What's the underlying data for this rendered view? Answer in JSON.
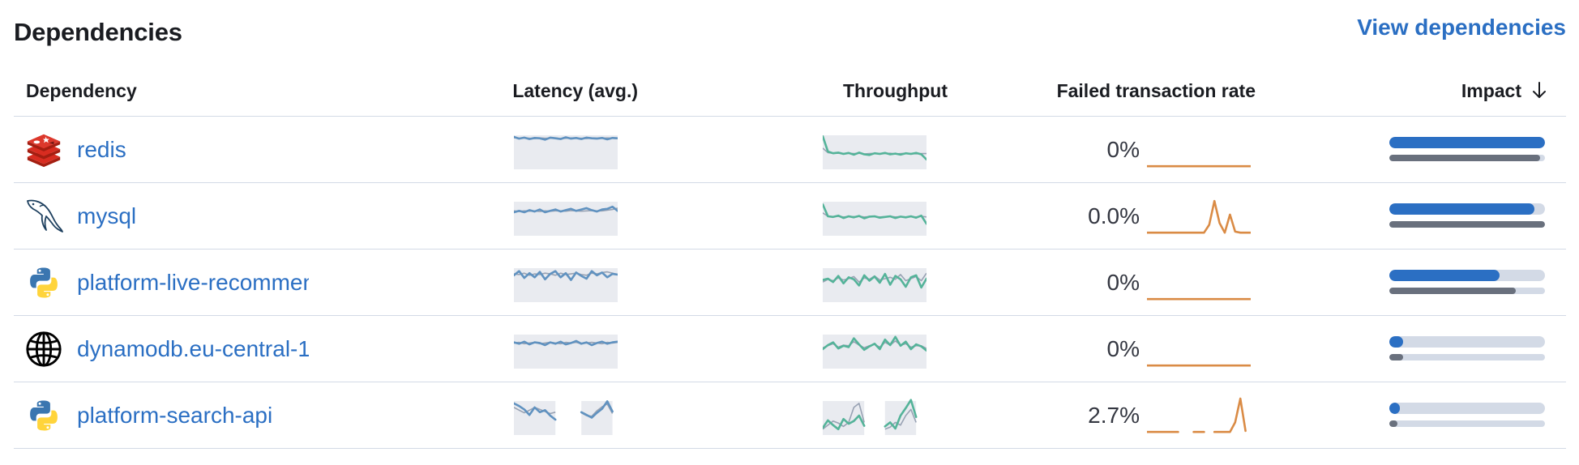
{
  "panel": {
    "title": "Dependencies",
    "view_link": "View dependencies"
  },
  "table": {
    "columns": {
      "dependency": "Dependency",
      "latency": "Latency (avg.)",
      "throughput": "Throughput",
      "failed": "Failed transaction rate",
      "impact": "Impact"
    },
    "sort_icon": "arrow-down-icon",
    "rows": [
      {
        "name": "redis",
        "icon": "redis-icon",
        "failed_rate": "0%",
        "impact": 1.0,
        "impact_previous": 0.97,
        "latency_series": [
          0.88,
          0.83,
          0.86,
          0.82,
          0.85,
          0.84,
          0.8,
          0.86,
          0.84,
          0.82,
          0.87,
          0.83,
          0.85,
          0.82,
          0.86,
          0.84,
          0.83,
          0.85,
          0.81,
          0.85,
          0.84
        ],
        "latency_previous": [
          0.86,
          0.84,
          0.85,
          0.84,
          0.83,
          0.85,
          0.84,
          0.84,
          0.85,
          0.83,
          0.84,
          0.85,
          0.84,
          0.84,
          0.83,
          0.85,
          0.84,
          0.84,
          0.85,
          0.84,
          0.83
        ],
        "throughput_series": [
          0.9,
          0.45,
          0.4,
          0.42,
          0.38,
          0.41,
          0.36,
          0.42,
          0.37,
          0.35,
          0.4,
          0.38,
          0.41,
          0.37,
          0.39,
          0.36,
          0.4,
          0.38,
          0.41,
          0.37,
          0.22
        ],
        "throughput_previous": [
          0.55,
          0.42,
          0.4,
          0.4,
          0.39,
          0.4,
          0.39,
          0.4,
          0.38,
          0.39,
          0.4,
          0.39,
          0.39,
          0.4,
          0.38,
          0.39,
          0.4,
          0.39,
          0.38,
          0.39,
          0.39
        ],
        "failed_series": [
          0.02,
          0.02,
          0.02,
          0.02,
          0.02,
          0.02,
          0.02,
          0.02,
          0.02,
          0.02,
          0.02,
          0.02,
          0.02,
          0.02,
          0.02,
          0.02,
          0.02,
          0.02,
          0.02,
          0.02,
          0.02
        ]
      },
      {
        "name": "mysql",
        "icon": "mysql-dolphin-icon",
        "failed_rate": "0.0%",
        "impact": 0.93,
        "impact_previous": 1.0,
        "latency_series": [
          0.62,
          0.66,
          0.62,
          0.68,
          0.64,
          0.7,
          0.62,
          0.66,
          0.7,
          0.64,
          0.68,
          0.72,
          0.66,
          0.7,
          0.74,
          0.68,
          0.64,
          0.7,
          0.72,
          0.78,
          0.66
        ],
        "latency_previous": [
          0.66,
          0.64,
          0.66,
          0.65,
          0.66,
          0.64,
          0.66,
          0.65,
          0.66,
          0.66,
          0.65,
          0.67,
          0.66,
          0.65,
          0.66,
          0.67,
          0.66,
          0.66,
          0.68,
          0.7,
          0.74
        ],
        "throughput_series": [
          0.85,
          0.5,
          0.48,
          0.52,
          0.45,
          0.5,
          0.47,
          0.51,
          0.44,
          0.49,
          0.5,
          0.46,
          0.48,
          0.5,
          0.45,
          0.49,
          0.47,
          0.5,
          0.46,
          0.52,
          0.28
        ],
        "throughput_previous": [
          0.6,
          0.5,
          0.49,
          0.5,
          0.48,
          0.49,
          0.49,
          0.5,
          0.48,
          0.49,
          0.49,
          0.48,
          0.49,
          0.5,
          0.48,
          0.49,
          0.48,
          0.49,
          0.48,
          0.5,
          0.48
        ],
        "failed_series": [
          0.02,
          0.02,
          0.02,
          0.02,
          0.02,
          0.02,
          0.02,
          0.02,
          0.02,
          0.02,
          0.02,
          0.02,
          0.25,
          0.95,
          0.3,
          0.02,
          0.55,
          0.05,
          0.02,
          0.02,
          0.02
        ]
      },
      {
        "name": "platform-live-recommendations",
        "icon": "python-icon",
        "failed_rate": "0%",
        "impact": 0.71,
        "impact_previous": 0.81,
        "latency_series": [
          0.72,
          0.84,
          0.64,
          0.78,
          0.66,
          0.82,
          0.6,
          0.76,
          0.84,
          0.66,
          0.78,
          0.58,
          0.8,
          0.7,
          0.62,
          0.84,
          0.72,
          0.8,
          0.66,
          0.76,
          0.74
        ],
        "latency_previous": [
          0.76,
          0.74,
          0.78,
          0.72,
          0.76,
          0.74,
          0.78,
          0.76,
          0.72,
          0.78,
          0.74,
          0.76,
          0.78,
          0.74,
          0.72,
          0.78,
          0.76,
          0.8,
          0.82,
          0.78,
          0.74
        ],
        "throughput_series": [
          0.58,
          0.62,
          0.52,
          0.7,
          0.48,
          0.66,
          0.6,
          0.42,
          0.72,
          0.56,
          0.68,
          0.5,
          0.76,
          0.44,
          0.7,
          0.6,
          0.38,
          0.66,
          0.72,
          0.36,
          0.62
        ],
        "throughput_previous": [
          0.52,
          0.6,
          0.56,
          0.64,
          0.58,
          0.62,
          0.68,
          0.52,
          0.64,
          0.6,
          0.7,
          0.58,
          0.62,
          0.66,
          0.6,
          0.74,
          0.56,
          0.62,
          0.68,
          0.56,
          0.78
        ],
        "failed_series": [
          0.02,
          0.02,
          0.02,
          0.02,
          0.02,
          0.02,
          0.02,
          0.02,
          0.02,
          0.02,
          0.02,
          0.02,
          0.02,
          0.02,
          0.02,
          0.02,
          0.02,
          0.02,
          0.02,
          0.02,
          0.02
        ]
      },
      {
        "name": "dynamodb.eu-central-1",
        "icon": "globe-icon",
        "failed_rate": "0%",
        "impact": 0.09,
        "impact_previous": 0.09,
        "latency_series": [
          0.7,
          0.66,
          0.72,
          0.64,
          0.7,
          0.68,
          0.62,
          0.7,
          0.66,
          0.72,
          0.64,
          0.68,
          0.74,
          0.66,
          0.7,
          0.62,
          0.68,
          0.72,
          0.66,
          0.7,
          0.72
        ],
        "latency_previous": [
          0.68,
          0.7,
          0.66,
          0.68,
          0.7,
          0.66,
          0.68,
          0.7,
          0.68,
          0.66,
          0.7,
          0.68,
          0.7,
          0.66,
          0.68,
          0.7,
          0.68,
          0.66,
          0.7,
          0.68,
          0.7
        ],
        "throughput_series": [
          0.5,
          0.62,
          0.7,
          0.52,
          0.6,
          0.56,
          0.82,
          0.64,
          0.48,
          0.58,
          0.66,
          0.5,
          0.78,
          0.62,
          0.86,
          0.6,
          0.72,
          0.5,
          0.64,
          0.58,
          0.46
        ],
        "throughput_previous": [
          0.54,
          0.6,
          0.66,
          0.56,
          0.62,
          0.6,
          0.72,
          0.62,
          0.54,
          0.6,
          0.64,
          0.56,
          0.7,
          0.62,
          0.74,
          0.62,
          0.66,
          0.56,
          0.6,
          0.6,
          0.52
        ],
        "failed_series": [
          0.02,
          0.02,
          0.02,
          0.02,
          0.02,
          0.02,
          0.02,
          0.02,
          0.02,
          0.02,
          0.02,
          0.02,
          0.02,
          0.02,
          0.02,
          0.02,
          0.02,
          0.02,
          0.02,
          0.02,
          0.02
        ]
      },
      {
        "name": "platform-search-api",
        "icon": "python-icon",
        "failed_rate": "2.7%",
        "impact": 0.07,
        "impact_previous": 0.05,
        "latency_series": [
          0.86,
          0.78,
          0.68,
          0.52,
          0.74,
          0.6,
          0.66,
          0.5,
          0.38,
          null,
          null,
          null,
          null,
          0.6,
          0.52,
          0.44,
          0.58,
          0.7,
          0.92,
          0.62,
          null
        ],
        "latency_previous": [
          0.74,
          0.66,
          0.58,
          0.66,
          0.74,
          0.68,
          0.62,
          0.56,
          0.6,
          null,
          null,
          null,
          null,
          0.58,
          0.5,
          0.48,
          0.64,
          0.76,
          0.84,
          0.56,
          null
        ],
        "throughput_series": [
          0.14,
          0.36,
          0.22,
          0.1,
          0.4,
          0.26,
          0.34,
          0.5,
          0.2,
          null,
          null,
          null,
          0.18,
          0.3,
          0.12,
          0.5,
          0.72,
          0.96,
          0.46,
          null,
          null
        ],
        "throughput_previous": [
          0.1,
          0.22,
          0.34,
          0.28,
          0.18,
          0.3,
          0.74,
          0.86,
          0.3,
          null,
          null,
          null,
          0.1,
          0.16,
          0.3,
          0.22,
          0.5,
          0.68,
          0.3,
          null,
          null
        ],
        "failed_series": [
          0.02,
          0.02,
          0.02,
          0.02,
          0.02,
          0.02,
          0.02,
          null,
          null,
          0.02,
          0.02,
          0.02,
          null,
          0.02,
          0.02,
          0.02,
          0.02,
          0.3,
          1.0,
          0.05,
          null
        ]
      }
    ]
  },
  "colors": {
    "link": "#2b6fc3",
    "latency": "#6092c0",
    "throughput": "#54b399",
    "failed": "#da8b45",
    "previous": "#98a2b3",
    "spark_bg": "#e9ebf0",
    "impact_fill": "#2b6fc3",
    "impact_prev_fill": "#69707d",
    "impact_track": "#d3dae6"
  }
}
